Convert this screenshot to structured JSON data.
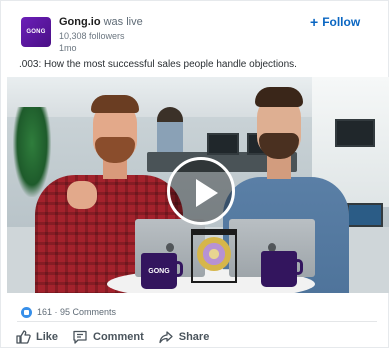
{
  "post": {
    "company": "Gong.io",
    "status": "was live",
    "followers": "10,308 followers",
    "time": "1mo",
    "logo_text": "GONG",
    "follow_label": "Follow",
    "text": ".003: How the most successful sales people handle objections."
  },
  "video": {
    "mug_text": "GONG"
  },
  "social": {
    "counts": "161 · 95 Comments"
  },
  "actions": {
    "like": "Like",
    "comment": "Comment",
    "share": "Share"
  },
  "colors": {
    "brand": "#4a0f86",
    "accent": "#0a66c2",
    "reaction": "#378fe9"
  },
  "icons": [
    "plus-icon",
    "play-icon",
    "like-reaction-icon",
    "thumbs-up-icon",
    "comment-icon",
    "share-icon"
  ]
}
